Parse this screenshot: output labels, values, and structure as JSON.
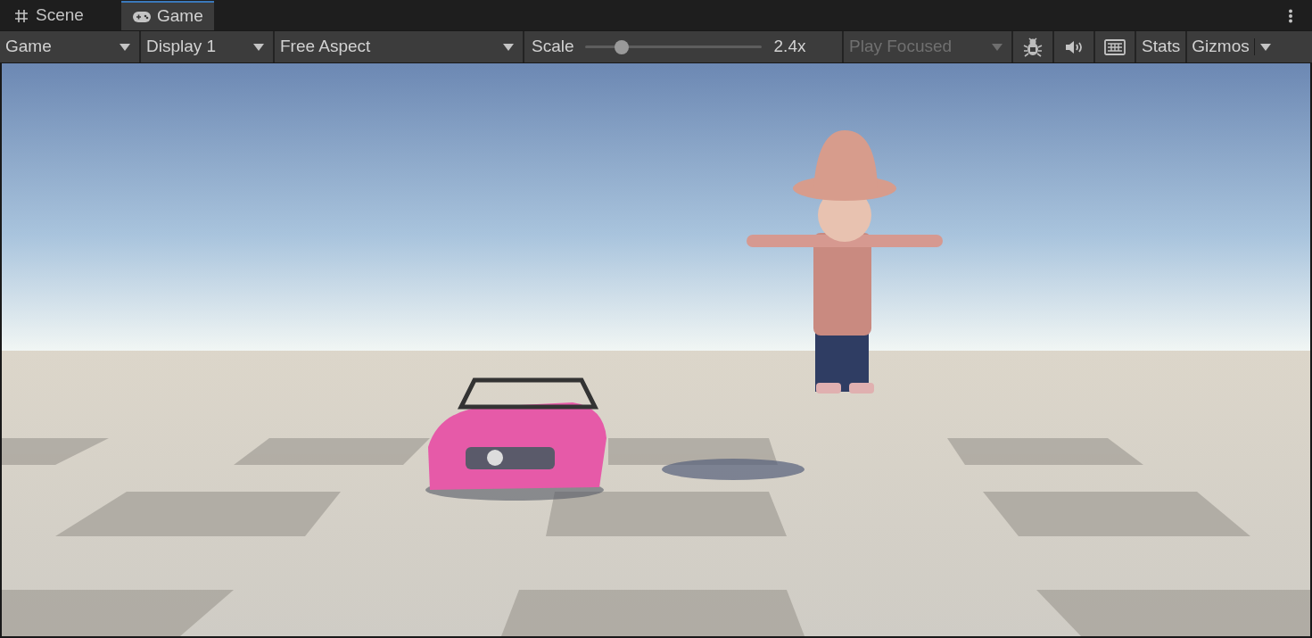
{
  "tabs": [
    {
      "label": "Scene",
      "selected": false
    },
    {
      "label": "Game",
      "selected": true
    }
  ],
  "toolbar": [
    {
      "kind": "dropdown",
      "label": "Game",
      "disabled": false
    },
    {
      "kind": "dropdown",
      "label": "Display 1",
      "disabled": false
    },
    {
      "kind": "dropdown",
      "label": "Free Aspect",
      "disabled": false
    },
    {
      "kind": "slider",
      "label": "Scale",
      "level": 0.21,
      "reading": "2.4x"
    },
    {
      "kind": "dropdown",
      "label": "Play Focused",
      "disabled": true
    },
    {
      "kind": "debug"
    },
    {
      "kind": "audio"
    },
    {
      "kind": "keyboard"
    },
    {
      "kind": "button",
      "label": "Stats"
    },
    {
      "kind": "split",
      "label": "Gizmos"
    }
  ]
}
